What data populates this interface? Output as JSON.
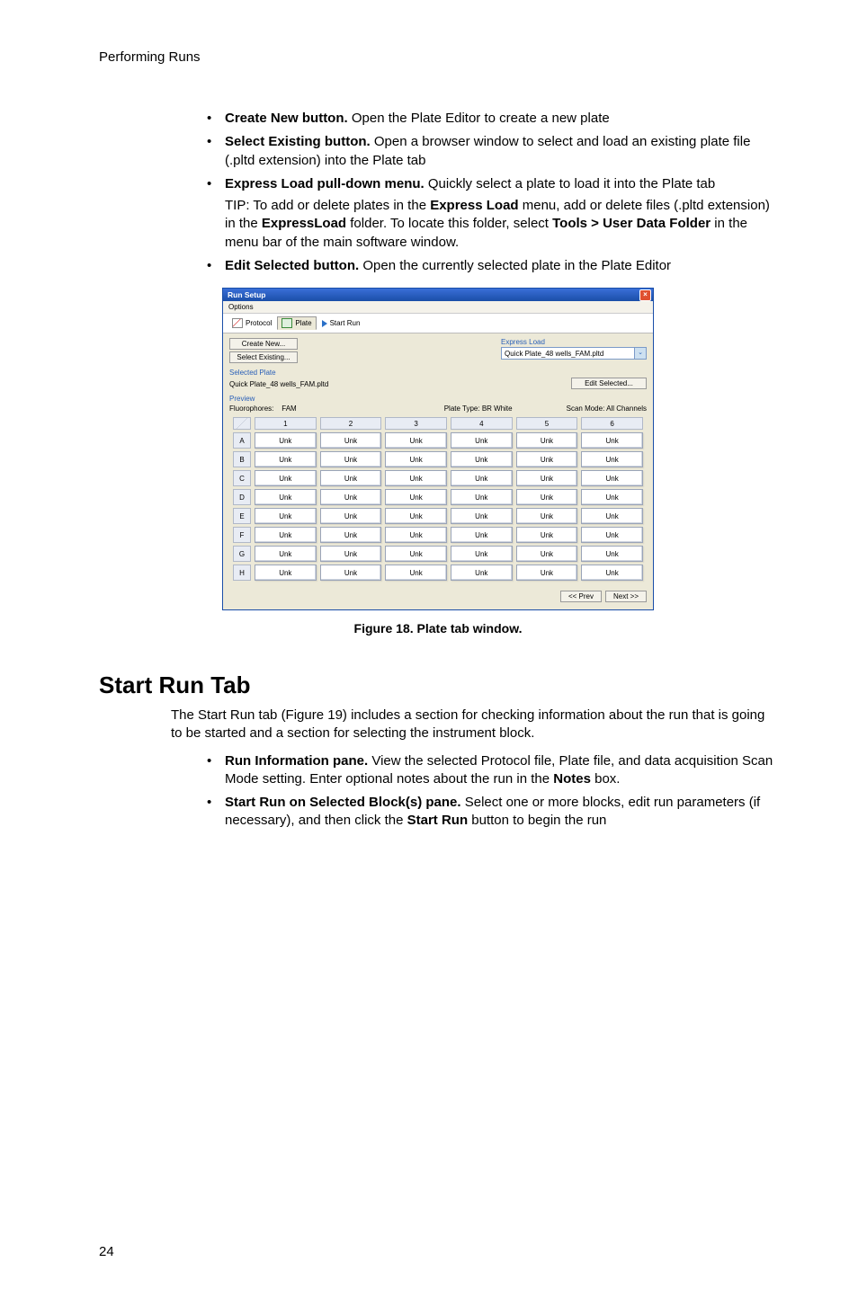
{
  "running_head": "Performing Runs",
  "page_number": "24",
  "bullets_top": [
    {
      "lead": "Create New button.",
      "text": " Open the Plate Editor to create a new plate"
    },
    {
      "lead": "Select Existing button.",
      "text": " Open a browser window to select and load an existing plate file (.pltd extension) into the Plate tab"
    },
    {
      "lead": "Express Load pull-down menu.",
      "text": " Quickly select a plate to load it into the Plate tab",
      "tip_pre": "TIP: To add or delete plates in the ",
      "tip_b1": "Express Load",
      "tip_mid1": " menu, add or delete files (.pltd extension) in the ",
      "tip_b2": "ExpressLoad",
      "tip_mid2": " folder. To locate this folder, select ",
      "tip_b3": "Tools > User Data Folder",
      "tip_post": " in the menu bar of the main software window."
    },
    {
      "lead": "Edit Selected button.",
      "text": " Open the currently selected plate in the Plate Editor"
    }
  ],
  "figure_caption": "Figure 18. Plate tab window.",
  "section_heading": "Start Run Tab",
  "section_lead": "The Start Run tab (Figure 19) includes a section for checking information about the run that is going to be started and a section for selecting the instrument block.",
  "bullets_bottom": [
    {
      "lead": "Run Information pane.",
      "text_pre": " View the selected Protocol file, Plate file, and data acquisition Scan Mode setting. Enter optional notes about the run in the ",
      "text_b1": "Notes",
      "text_post": " box."
    },
    {
      "lead": "Start Run on Selected Block(s) pane.",
      "text_pre": " Select one or more blocks, edit run parameters (if necessary), and then click the ",
      "text_b1": "Start Run",
      "text_post": " button to begin the run"
    }
  ],
  "app": {
    "title": "Run Setup",
    "menu": "Options",
    "tabs": {
      "protocol": "Protocol",
      "plate": "Plate",
      "start_run": "Start Run"
    },
    "buttons": {
      "create_new": "Create New...",
      "select_existing": "Select Existing...",
      "edit_selected": "Edit Selected...",
      "prev": "<< Prev",
      "next": "Next >>"
    },
    "express_label": "Express Load",
    "express_value": "Quick Plate_48 wells_FAM.pltd",
    "selected_plate_label": "Selected Plate",
    "selected_plate_value": "Quick Plate_48 wells_FAM.pltd",
    "preview_label": "Preview",
    "fluor_label": "Fluorophores:",
    "fluor_value": "FAM",
    "plate_type": "Plate Type: BR White",
    "scan_mode": "Scan Mode: All Channels",
    "cols": [
      "1",
      "2",
      "3",
      "4",
      "5",
      "6"
    ],
    "rows": [
      "A",
      "B",
      "C",
      "D",
      "E",
      "F",
      "G",
      "H"
    ],
    "cell": "Unk"
  }
}
